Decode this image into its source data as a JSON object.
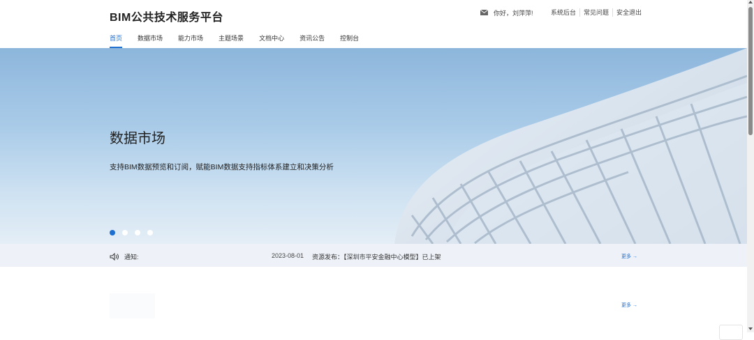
{
  "header": {
    "logo": "BIM公共技术服务平台",
    "greeting": "你好，刘萍萍!",
    "links": [
      "系统后台",
      "常见问题",
      "安全退出"
    ],
    "nav": [
      {
        "label": "首页",
        "active": true
      },
      {
        "label": "数据市场"
      },
      {
        "label": "能力市场"
      },
      {
        "label": "主题场景"
      },
      {
        "label": "文档中心"
      },
      {
        "label": "资讯公告"
      },
      {
        "label": "控制台"
      }
    ]
  },
  "banner": {
    "title": "数据市场",
    "subtitle": "支持BIM数据预览和订阅，赋能BIM数据支持指标体系建立和决策分析",
    "slides": 4,
    "active_slide": 1
  },
  "notice": {
    "label": "通知:",
    "date": "2023-08-01",
    "text": "资源发布：【深圳市平安金融中心模型】已上架",
    "more": "更多 →"
  },
  "section": {
    "more": "更多 →"
  },
  "colors": {
    "accent": "#1f6fd1",
    "notice_bg": "#eef2f8"
  }
}
